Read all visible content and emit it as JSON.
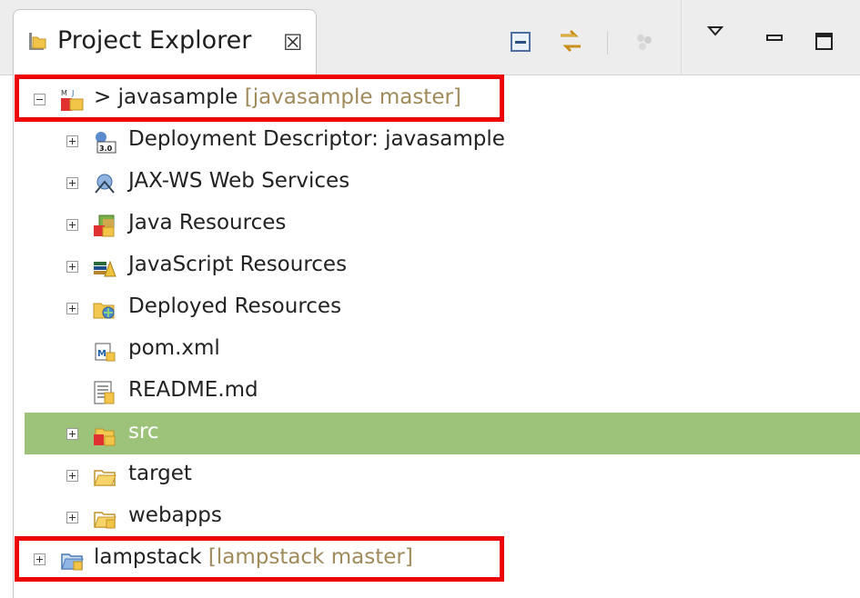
{
  "tab": {
    "title": "Project Explorer",
    "close_glyph": "☒"
  },
  "toolbar": {
    "collapse_all_icon": "collapse-all-icon",
    "link_editor_icon": "link-with-editor-icon",
    "focus_icon": "focus-on-active-task-icon",
    "view_menu_icon": "view-menu-icon",
    "minimize_icon": "minimize-icon",
    "maximize_icon": "maximize-icon"
  },
  "tree": {
    "root": {
      "prefix": "> ",
      "name": "javasample",
      "decoration": "[javasample master]",
      "expanded": true
    },
    "children": [
      {
        "label": "Deployment Descriptor: javasample",
        "icon": "deployment-descriptor-icon",
        "expandable": true
      },
      {
        "label": "JAX-WS Web Services",
        "icon": "web-services-icon",
        "expandable": true
      },
      {
        "label": "Java Resources",
        "icon": "java-resources-icon",
        "expandable": true
      },
      {
        "label": "JavaScript Resources",
        "icon": "javascript-resources-icon",
        "expandable": true
      },
      {
        "label": "Deployed Resources",
        "icon": "deployed-resources-icon",
        "expandable": true
      },
      {
        "label": "pom.xml",
        "icon": "maven-pom-file-icon",
        "expandable": false
      },
      {
        "label": "README.md",
        "icon": "text-file-icon",
        "expandable": false
      },
      {
        "label": "src",
        "icon": "source-folder-icon",
        "expandable": true,
        "selected": true
      },
      {
        "label": "target",
        "icon": "folder-icon",
        "expandable": true
      },
      {
        "label": "webapps",
        "icon": "folder-icon",
        "expandable": true
      }
    ],
    "second_root": {
      "name": "lampstack",
      "decoration": "[lampstack master]",
      "expanded": false
    }
  },
  "colors": {
    "selection": "#9dc27a",
    "decoration_text": "#a08a5a",
    "highlight_box": "#ee0000"
  }
}
